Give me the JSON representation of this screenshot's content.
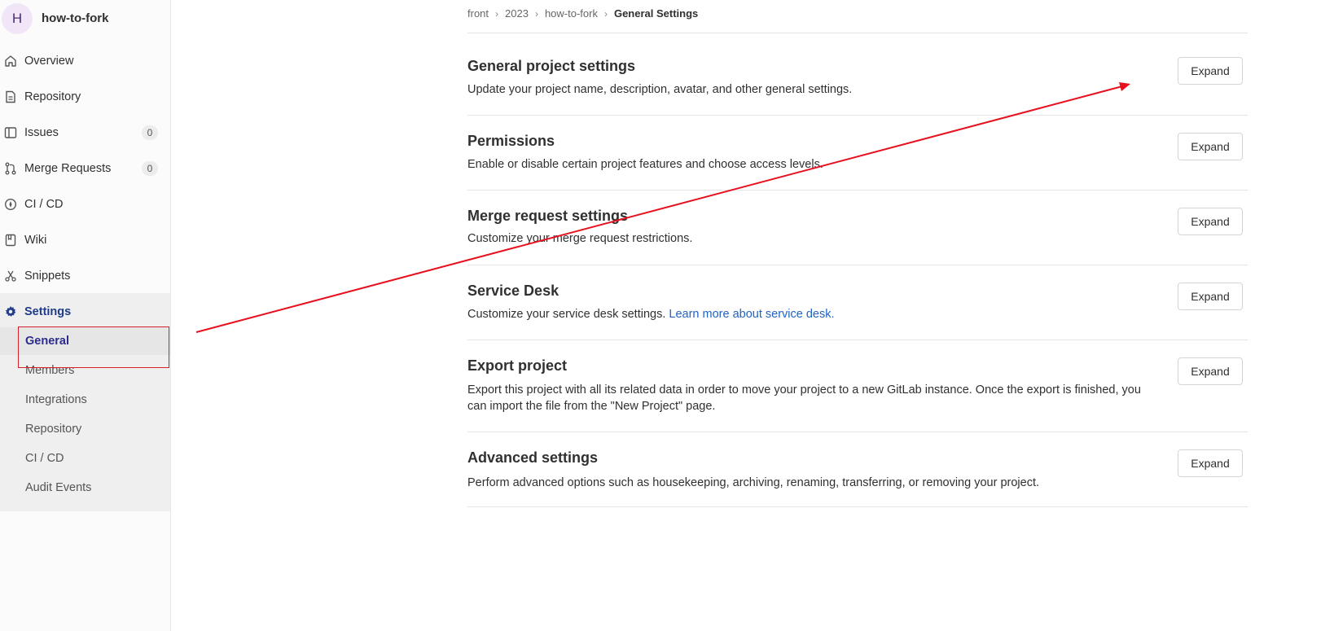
{
  "project": {
    "avatar_letter": "H",
    "name": "how-to-fork"
  },
  "sidebar": {
    "items": [
      {
        "label": "Overview"
      },
      {
        "label": "Repository"
      },
      {
        "label": "Issues",
        "count": "0"
      },
      {
        "label": "Merge Requests",
        "count": "0"
      },
      {
        "label": "CI / CD"
      },
      {
        "label": "Wiki"
      },
      {
        "label": "Snippets"
      },
      {
        "label": "Settings"
      }
    ],
    "settings_sub": [
      {
        "label": "General"
      },
      {
        "label": "Members"
      },
      {
        "label": "Integrations"
      },
      {
        "label": "Repository"
      },
      {
        "label": "CI / CD"
      },
      {
        "label": "Audit Events"
      }
    ]
  },
  "breadcrumb": [
    "front",
    "2023",
    "how-to-fork",
    "General Settings"
  ],
  "sections": [
    {
      "title": "General project settings",
      "description": "Update your project name, description, avatar, and other general settings.",
      "button": "Expand"
    },
    {
      "title": "Permissions",
      "description": "Enable or disable certain project features and choose access levels.",
      "button": "Expand"
    },
    {
      "title": "Merge request settings",
      "description": "Customize your merge request restrictions.",
      "button": "Expand"
    },
    {
      "title": "Service Desk",
      "description": "Customize your service desk settings.",
      "link": "Learn more about service desk.",
      "button": "Expand"
    },
    {
      "title": "Export project",
      "description": "Export this project with all its related data in order to move your project to a new GitLab instance. Once the export is finished, you can import the file from the \"New Project\" page.",
      "button": "Expand"
    },
    {
      "title": "Advanced settings",
      "description": "Perform advanced options such as housekeeping, archiving, renaming, transferring, or removing your project.",
      "button": "Expand"
    }
  ],
  "colors": {
    "annotation": "#e8101e",
    "settings_active": "#1f3b8a",
    "link": "#1f63c4"
  }
}
